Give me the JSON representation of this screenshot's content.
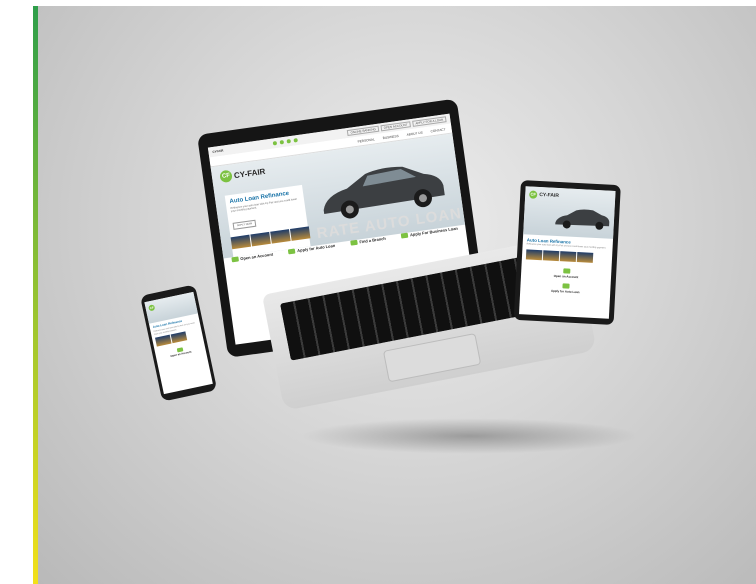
{
  "site": {
    "brand": "CY-FAIR",
    "logo_mark": "CF",
    "top_small": "CYFAIR",
    "top_tabs": [
      "ONLINE BANKING",
      "OPEN ACCOUNT",
      "APPLY FOR A LOAN"
    ],
    "nav": [
      "PERSONAL",
      "BUSINESS",
      "ABOUT US",
      "CONTACT"
    ],
    "hero_title": "Auto Loan Refinance",
    "hero_body": "Refinance your auto loan with Cy-Fair and you could lower your monthly payment.",
    "hero_button": "APPLY NOW",
    "watermark_line1": "RATE",
    "watermark_line2": "AUTO LOAN REFI",
    "features": [
      "Open an Account",
      "Apply for Auto Loan",
      "Find a Branch",
      "Apply For Business Loan"
    ]
  },
  "colors": {
    "accent_green": "#7cc242",
    "title_blue": "#1a74a8",
    "device_black": "#151515"
  }
}
